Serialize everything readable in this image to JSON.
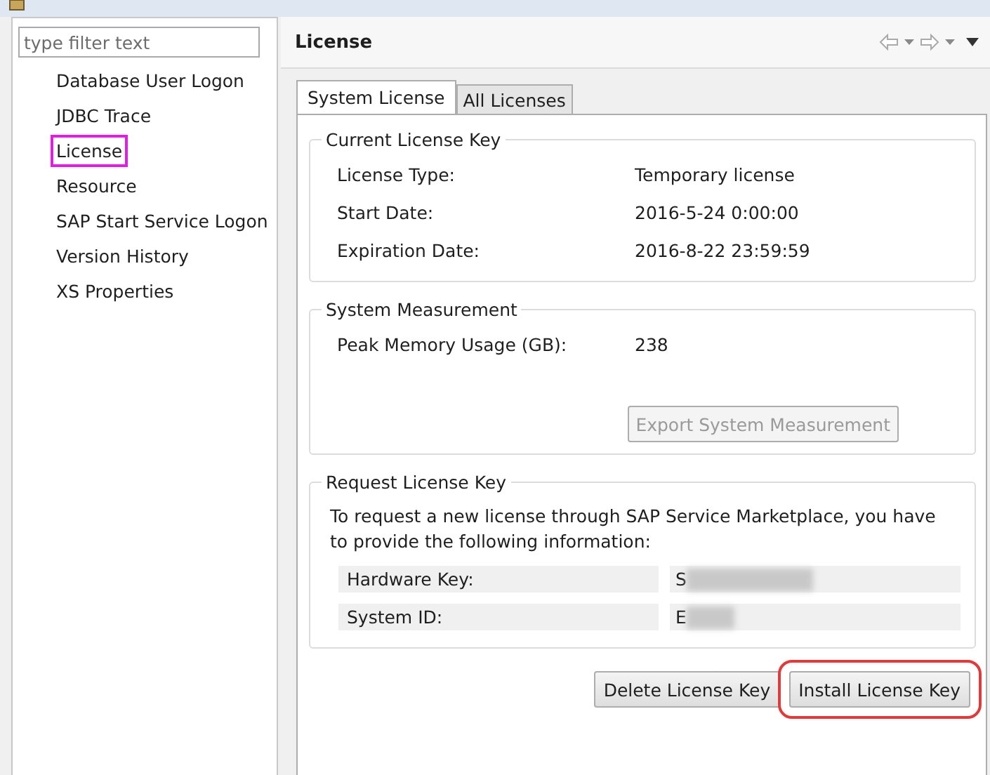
{
  "filter": {
    "placeholder": "type filter text"
  },
  "sidebar": {
    "items": [
      {
        "label": "Database User Logon",
        "selected": false
      },
      {
        "label": "JDBC Trace",
        "selected": false
      },
      {
        "label": "License",
        "selected": true
      },
      {
        "label": "Resource",
        "selected": false
      },
      {
        "label": "SAP Start Service Logon",
        "selected": false
      },
      {
        "label": "Version History",
        "selected": false
      },
      {
        "label": "XS Properties",
        "selected": false
      }
    ]
  },
  "page": {
    "title": "License"
  },
  "tabs": [
    {
      "label": "System License",
      "selected": true
    },
    {
      "label": "All Licenses",
      "selected": false
    }
  ],
  "current_license_key": {
    "title": "Current License Key",
    "rows": [
      {
        "label": "License Type:",
        "value": "Temporary license"
      },
      {
        "label": "Start Date:",
        "value": "2016-5-24 0:00:00"
      },
      {
        "label": "Expiration Date:",
        "value": "2016-8-22 23:59:59"
      }
    ]
  },
  "system_measurement": {
    "title": "System Measurement",
    "rows": [
      {
        "label": "Peak Memory Usage (GB):",
        "value": "238"
      }
    ],
    "button": {
      "label": "Export System Measurement",
      "disabled": true
    }
  },
  "request_license_key": {
    "title": "Request License Key",
    "text": "To request a new license through SAP Service Marketplace, you have to provide the following information:",
    "fields": [
      {
        "label": "Hardware Key:",
        "value": "S"
      },
      {
        "label": "System ID:",
        "value": "E"
      }
    ]
  },
  "buttons": [
    {
      "label": "Delete License Key",
      "highlighted": false
    },
    {
      "label": "Install License Key",
      "highlighted": true
    }
  ]
}
